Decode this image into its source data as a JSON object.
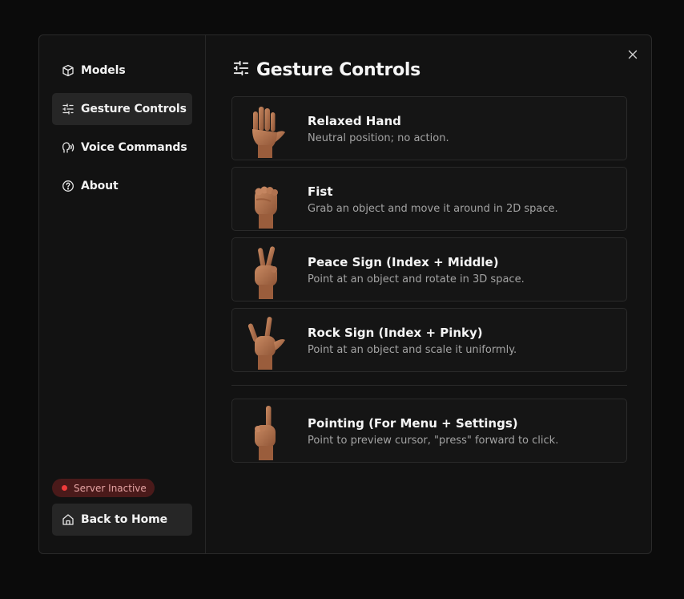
{
  "sidebar": {
    "items": [
      {
        "label": "Models",
        "icon": "cube-icon",
        "active": false
      },
      {
        "label": "Gesture Controls",
        "icon": "sliders-icon",
        "active": true
      },
      {
        "label": "Voice Commands",
        "icon": "voice-icon",
        "active": false
      },
      {
        "label": "About",
        "icon": "help-circle-icon",
        "active": false
      }
    ],
    "status": {
      "label": "Server Inactive",
      "color": "#ef3b3b"
    },
    "back_label": "Back to Home"
  },
  "main": {
    "title": "Gesture Controls",
    "title_icon": "sliders-icon",
    "gestures": [
      {
        "name": "Relaxed Hand",
        "description": "Neutral position; no action.",
        "icon": "open-hand-icon"
      },
      {
        "name": "Fist",
        "description": "Grab an object and move it around in 2D space.",
        "icon": "fist-icon"
      },
      {
        "name": "Peace Sign (Index + Middle)",
        "description": "Point at an object and rotate in 3D space.",
        "icon": "peace-sign-icon"
      },
      {
        "name": "Rock Sign (Index + Pinky)",
        "description": "Point at an object and scale it uniformly.",
        "icon": "rock-sign-icon"
      }
    ],
    "extra_gestures": [
      {
        "name": "Pointing (For Menu + Settings)",
        "description": "Point to preview cursor, \"press\" forward to click.",
        "icon": "pointing-hand-icon"
      }
    ]
  },
  "colors": {
    "background": "#0b0b0b",
    "panel": "#121212",
    "card": "#151515",
    "active": "#262626",
    "skin": "#b8754f"
  }
}
